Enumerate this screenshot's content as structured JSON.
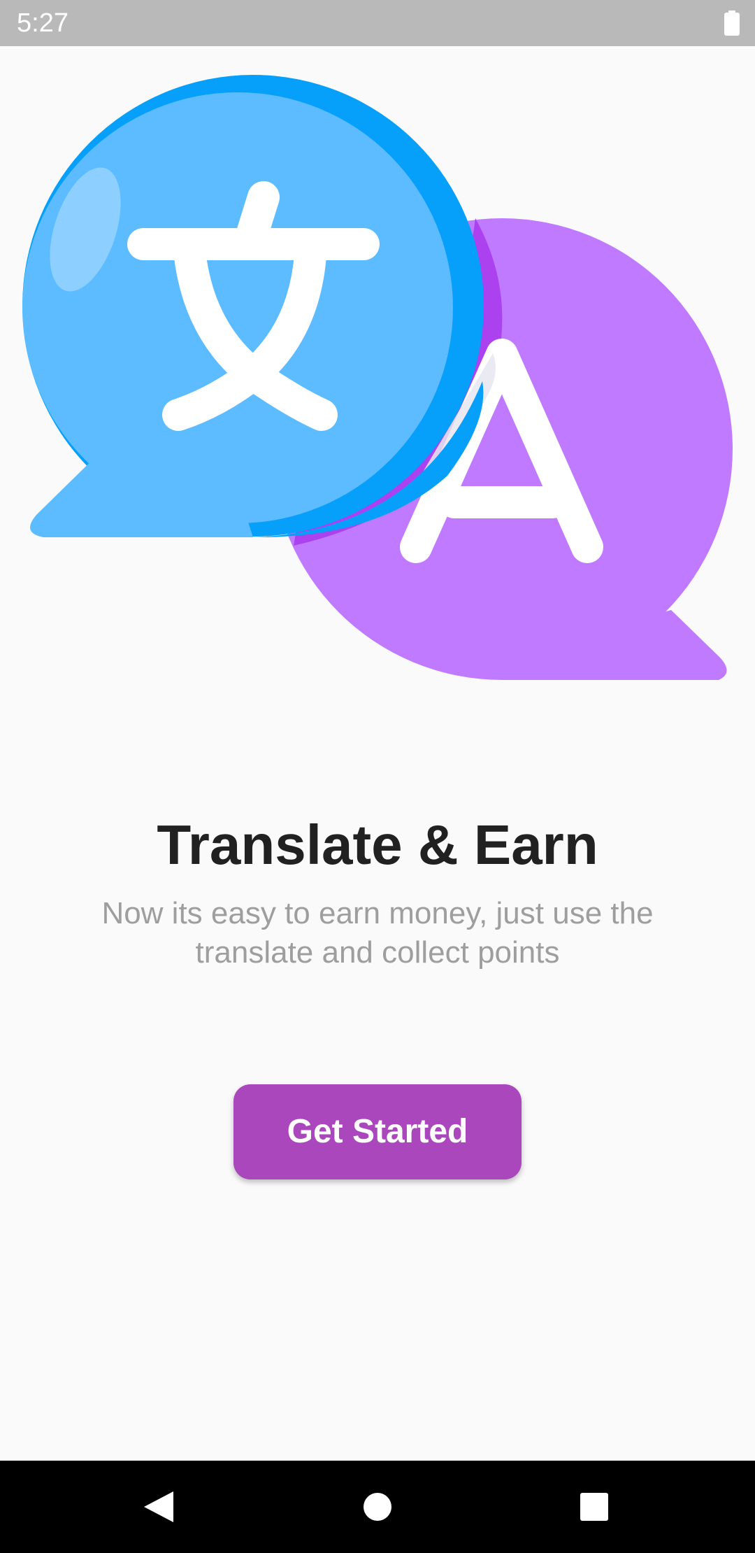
{
  "status_bar": {
    "time": "5:27",
    "battery_icon": "battery-full-icon"
  },
  "hero": {
    "illustration": "translate-chat-bubbles-icon",
    "colors": {
      "blue_bubble": "#5cbcff",
      "blue_shade": "#069ff9",
      "purple_bubble": "#c07aff",
      "purple_shade": "#ac42ef",
      "glyph": "#ffffff"
    }
  },
  "onboarding": {
    "title": "Translate & Earn",
    "subtitle": "Now its easy to earn money, just use the translate and collect points",
    "cta_label": "Get Started",
    "accent_color": "#ab47bc"
  },
  "nav_bar": {
    "back_icon": "back-triangle-icon",
    "home_icon": "home-circle-icon",
    "recents_icon": "recents-square-icon"
  }
}
